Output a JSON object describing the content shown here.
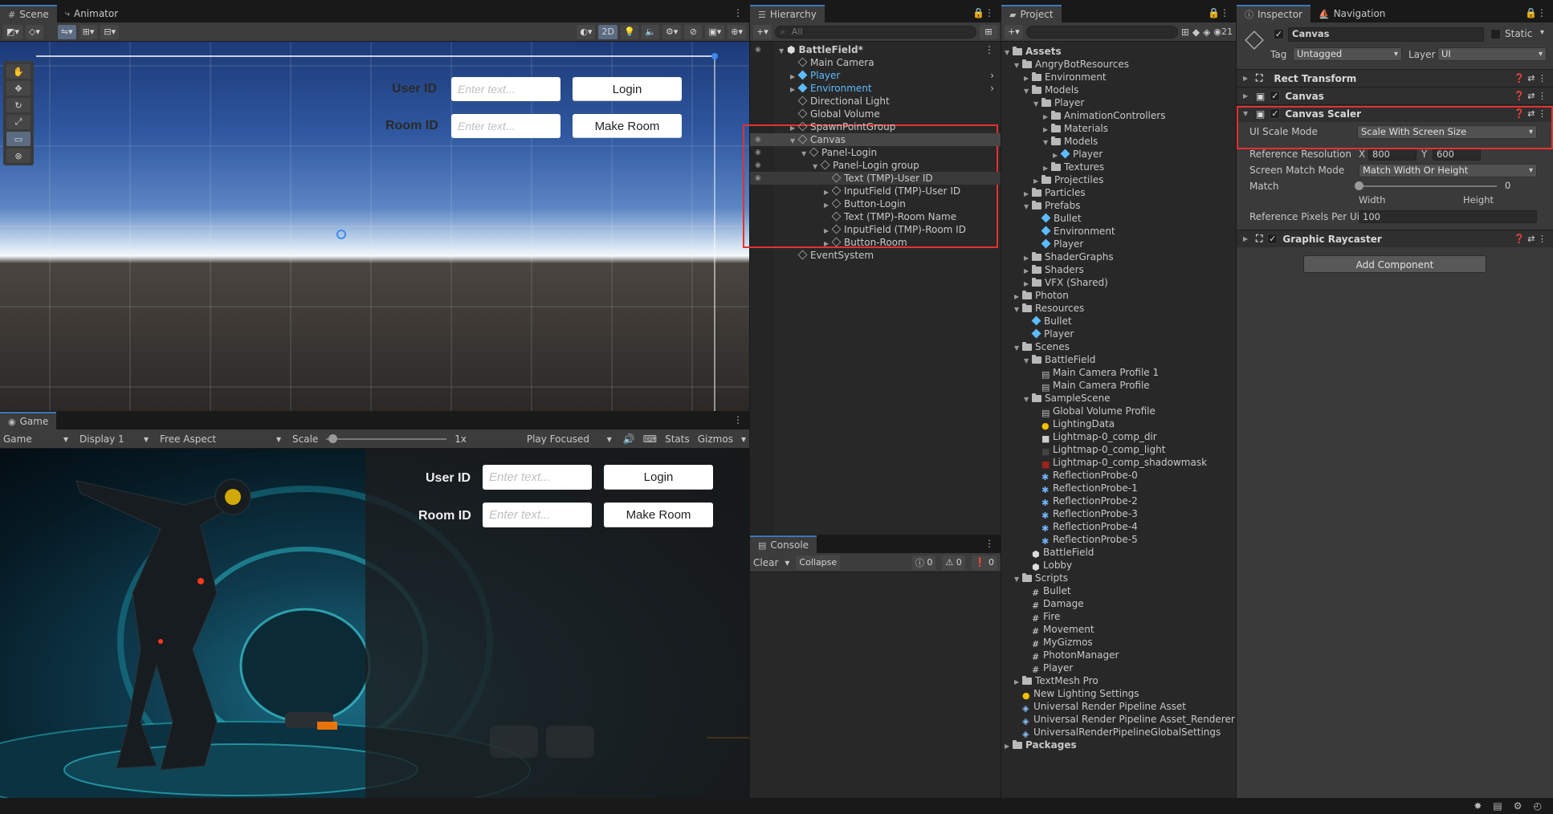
{
  "scene": {
    "tabs": [
      {
        "label": "Scene"
      },
      {
        "label": "Animator"
      }
    ],
    "toolbar": {
      "two_d": "2D"
    },
    "ui": {
      "user_id_label": "User ID",
      "room_id_label": "Room ID",
      "input_placeholder": "Enter text...",
      "login_label": "Login",
      "make_room_label": "Make Room"
    }
  },
  "game": {
    "tab": "Game",
    "toolbar": {
      "mode": "Game",
      "display": "Display 1",
      "aspect": "Free Aspect",
      "scale_label": "Scale",
      "scale_value": 0.02,
      "scale_text": "1x",
      "play_mode": "Play Focused",
      "stats": "Stats",
      "gizmos": "Gizmos"
    },
    "ui": {
      "user_id_label": "User ID",
      "room_id_label": "Room ID",
      "input_placeholder": "Enter text...",
      "login_label": "Login",
      "make_room_label": "Make Room"
    }
  },
  "hierarchy": {
    "tab": "Hierarchy",
    "search_placeholder": "All",
    "rows": [
      {
        "label": "BattleField*",
        "depth": 0,
        "kind": "scene",
        "expanded": true,
        "bold": true
      },
      {
        "label": "Main Camera",
        "depth": 1,
        "kind": "go"
      },
      {
        "label": "Player",
        "depth": 1,
        "kind": "prefab",
        "collapsed": true
      },
      {
        "label": "Environment",
        "depth": 1,
        "kind": "prefab",
        "collapsed": true
      },
      {
        "label": "Directional Light",
        "depth": 1,
        "kind": "go"
      },
      {
        "label": "Global Volume",
        "depth": 1,
        "kind": "go"
      },
      {
        "label": "SpawnPointGroup",
        "depth": 1,
        "kind": "go",
        "collapsed": true
      },
      {
        "label": "Canvas",
        "depth": 1,
        "kind": "go",
        "expanded": true,
        "selected": true
      },
      {
        "label": "Panel-Login",
        "depth": 2,
        "kind": "go",
        "expanded": true
      },
      {
        "label": "Panel-Login group",
        "depth": 3,
        "kind": "go",
        "expanded": true
      },
      {
        "label": "Text (TMP)-User ID",
        "depth": 4,
        "kind": "go",
        "hover": true
      },
      {
        "label": "InputField (TMP)-User ID",
        "depth": 4,
        "kind": "go",
        "collapsed": true
      },
      {
        "label": "Button-Login",
        "depth": 4,
        "kind": "go",
        "collapsed": true
      },
      {
        "label": "Text (TMP)-Room Name",
        "depth": 4,
        "kind": "go"
      },
      {
        "label": "InputField (TMP)-Room ID",
        "depth": 4,
        "kind": "go",
        "collapsed": true
      },
      {
        "label": "Button-Room",
        "depth": 4,
        "kind": "go",
        "collapsed": true
      },
      {
        "label": "EventSystem",
        "depth": 1,
        "kind": "go"
      }
    ]
  },
  "console": {
    "tab": "Console",
    "clear": "Clear",
    "collapse": "Collapse",
    "counts": [
      "0",
      "0",
      "0"
    ]
  },
  "project": {
    "tab": "Project",
    "count": "21",
    "rows": [
      {
        "label": "Assets",
        "depth": 0,
        "kind": "folder",
        "expanded": true,
        "bold": true
      },
      {
        "label": "AngryBotResources",
        "depth": 1,
        "kind": "folder",
        "expanded": true
      },
      {
        "label": "Environment",
        "depth": 2,
        "kind": "folder",
        "collapsed": true
      },
      {
        "label": "Models",
        "depth": 2,
        "kind": "folder",
        "expanded": true
      },
      {
        "label": "Player",
        "depth": 3,
        "kind": "folder",
        "expanded": true
      },
      {
        "label": "AnimationControllers",
        "depth": 4,
        "kind": "folder",
        "collapsed": true
      },
      {
        "label": "Materials",
        "depth": 4,
        "kind": "folder",
        "collapsed": true
      },
      {
        "label": "Models",
        "depth": 4,
        "kind": "folder",
        "expanded": true
      },
      {
        "label": "Player",
        "depth": 5,
        "kind": "prefab",
        "collapsed": true
      },
      {
        "label": "Textures",
        "depth": 4,
        "kind": "folder",
        "collapsed": true
      },
      {
        "label": "Projectiles",
        "depth": 3,
        "kind": "folder",
        "collapsed": true
      },
      {
        "label": "Particles",
        "depth": 2,
        "kind": "folder",
        "collapsed": true
      },
      {
        "label": "Prefabs",
        "depth": 2,
        "kind": "folder",
        "expanded": true
      },
      {
        "label": "Bullet",
        "depth": 3,
        "kind": "prefab"
      },
      {
        "label": "Environment",
        "depth": 3,
        "kind": "prefab"
      },
      {
        "label": "Player",
        "depth": 3,
        "kind": "prefab"
      },
      {
        "label": "ShaderGraphs",
        "depth": 2,
        "kind": "folder",
        "collapsed": true
      },
      {
        "label": "Shaders",
        "depth": 2,
        "kind": "folder",
        "collapsed": true
      },
      {
        "label": "VFX (Shared)",
        "depth": 2,
        "kind": "folder",
        "collapsed": true
      },
      {
        "label": "Photon",
        "depth": 1,
        "kind": "folder",
        "collapsed": true
      },
      {
        "label": "Resources",
        "depth": 1,
        "kind": "folder",
        "expanded": true
      },
      {
        "label": "Bullet",
        "depth": 2,
        "kind": "prefab"
      },
      {
        "label": "Player",
        "depth": 2,
        "kind": "prefab"
      },
      {
        "label": "Scenes",
        "depth": 1,
        "kind": "folder",
        "expanded": true
      },
      {
        "label": "BattleField",
        "depth": 2,
        "kind": "folder",
        "expanded": true
      },
      {
        "label": "Main Camera Profile 1",
        "depth": 3,
        "kind": "asset"
      },
      {
        "label": "Main Camera Profile",
        "depth": 3,
        "kind": "asset"
      },
      {
        "label": "SampleScene",
        "depth": 2,
        "kind": "folder",
        "expanded": true
      },
      {
        "label": "Global Volume Profile",
        "depth": 3,
        "kind": "asset"
      },
      {
        "label": "LightingData",
        "depth": 3,
        "kind": "lighting"
      },
      {
        "label": "Lightmap-0_comp_dir",
        "depth": 3,
        "kind": "texture"
      },
      {
        "label": "Lightmap-0_comp_light",
        "depth": 3,
        "kind": "texture-dark"
      },
      {
        "label": "Lightmap-0_comp_shadowmask",
        "depth": 3,
        "kind": "texture-red"
      },
      {
        "label": "ReflectionProbe-0",
        "depth": 3,
        "kind": "probe"
      },
      {
        "label": "ReflectionProbe-1",
        "depth": 3,
        "kind": "probe"
      },
      {
        "label": "ReflectionProbe-2",
        "depth": 3,
        "kind": "probe"
      },
      {
        "label": "ReflectionProbe-3",
        "depth": 3,
        "kind": "probe"
      },
      {
        "label": "ReflectionProbe-4",
        "depth": 3,
        "kind": "probe"
      },
      {
        "label": "ReflectionProbe-5",
        "depth": 3,
        "kind": "probe"
      },
      {
        "label": "BattleField",
        "depth": 2,
        "kind": "scene"
      },
      {
        "label": "Lobby",
        "depth": 2,
        "kind": "scene"
      },
      {
        "label": "Scripts",
        "depth": 1,
        "kind": "folder",
        "expanded": true
      },
      {
        "label": "Bullet",
        "depth": 2,
        "kind": "script"
      },
      {
        "label": "Damage",
        "depth": 2,
        "kind": "script"
      },
      {
        "label": "Fire",
        "depth": 2,
        "kind": "script"
      },
      {
        "label": "Movement",
        "depth": 2,
        "kind": "script"
      },
      {
        "label": "MyGizmos",
        "depth": 2,
        "kind": "script"
      },
      {
        "label": "PhotonManager",
        "depth": 2,
        "kind": "script"
      },
      {
        "label": "Player",
        "depth": 2,
        "kind": "script"
      },
      {
        "label": "TextMesh Pro",
        "depth": 1,
        "kind": "folder",
        "collapsed": true
      },
      {
        "label": "New Lighting Settings",
        "depth": 1,
        "kind": "lighting"
      },
      {
        "label": "Universal Render Pipeline Asset",
        "depth": 1,
        "kind": "pipeline"
      },
      {
        "label": "Universal Render Pipeline Asset_Renderer",
        "depth": 1,
        "kind": "pipeline"
      },
      {
        "label": "UniversalRenderPipelineGlobalSettings",
        "depth": 1,
        "kind": "pipeline"
      },
      {
        "label": "Packages",
        "depth": 0,
        "kind": "folder",
        "collapsed": true,
        "bold": true
      }
    ]
  },
  "inspector": {
    "tabs": [
      {
        "label": "Inspector"
      },
      {
        "label": "Navigation"
      }
    ],
    "object_name": "Canvas",
    "static_label": "Static",
    "tag_label": "Tag",
    "tag_value": "Untagged",
    "layer_label": "Layer",
    "layer_value": "UI",
    "components": {
      "rect_transform": "Rect Transform",
      "canvas": "Canvas",
      "canvas_scaler": "Canvas Scaler",
      "graphic_raycaster": "Graphic Raycaster"
    },
    "scaler": {
      "ui_scale_mode_label": "UI Scale Mode",
      "ui_scale_mode_value": "Scale With Screen Size",
      "ref_res_label": "Reference Resolution",
      "x_label": "X",
      "x_value": "800",
      "y_label": "Y",
      "y_value": "600",
      "screen_match_label": "Screen Match Mode",
      "screen_match_value": "Match Width Or Height",
      "match_label": "Match",
      "match_value": "0",
      "match_slider": 0,
      "width_label": "Width",
      "height_label": "Height",
      "ref_ppu_label": "Reference Pixels Per Ui",
      "ref_ppu_value": "100"
    },
    "add_component": "Add Component"
  },
  "colors": {
    "accent": "#3a79bb",
    "highlight": "#e4312e",
    "prefab": "#5dbbff"
  }
}
